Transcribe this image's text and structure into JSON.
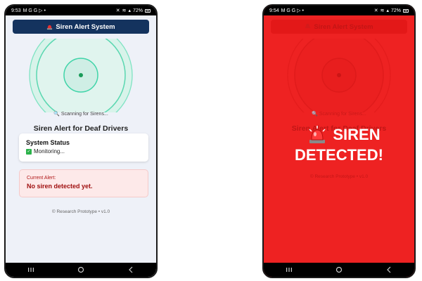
{
  "left_phone": {
    "status_bar": {
      "time": "9:53",
      "notif_icons": "M G G ▷ •",
      "battery": "72%"
    },
    "header": {
      "title": "Siren Alert System"
    },
    "scan_text": "Scanning for Sirens...",
    "app_title": "Siren Alert for Deaf Drivers",
    "status_card": {
      "title": "System Status",
      "value": "Monitoring..."
    },
    "alert_card": {
      "label": "Current Alert:",
      "value": "No siren detected yet."
    },
    "footer": "© Research Prototype • v1.0"
  },
  "right_phone": {
    "status_bar": {
      "time": "9:54",
      "notif_icons": "M G G ▷ •",
      "battery": "72%"
    },
    "header": {
      "title": "Siren Alert System"
    },
    "scan_text": "Scanning for Sirens...",
    "app_title": "Siren Alert for Deaf Drivers",
    "footer": "© Research Prototype • v1.0",
    "overlay": {
      "line1": "SIREN",
      "line2": "DETECTED!"
    }
  },
  "colors": {
    "header_bg": "#14335e",
    "alert_red": "#ee2222",
    "radar_green": "#3fd4a8",
    "app_bg": "#eef1f8"
  },
  "icons": {
    "header": "siren-emoji-icon",
    "scan": "magnifier-icon",
    "status": "check-icon",
    "overlay": "siren-emoji-icon"
  }
}
